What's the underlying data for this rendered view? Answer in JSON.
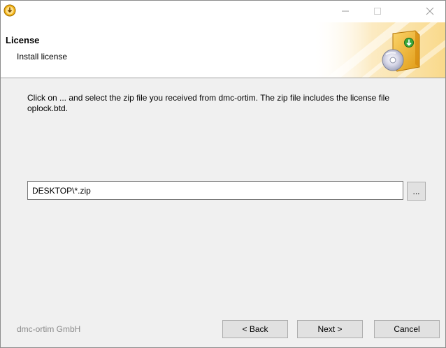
{
  "window": {
    "minimize_symbol": "—",
    "maximize_symbol": "☐",
    "close_symbol": "✕"
  },
  "header": {
    "title": "License",
    "subtitle": "Install license"
  },
  "content": {
    "instruction": "Click on ... and select the zip file you received from dmc-ortim. The zip file includes the license file oplock.btd.",
    "path_value": "DESKTOP\\*.zip",
    "browse_label": "..."
  },
  "footer": {
    "brand": "dmc-ortim GmbH",
    "back_label": "< Back",
    "next_label": "Next >",
    "cancel_label": "Cancel"
  },
  "colors": {
    "accent": "#f2a51a",
    "header_bg": "#ffffff",
    "window_bg": "#f0f0f0"
  },
  "icons": {
    "app": "installer-icon",
    "header": "cd-package-icon"
  }
}
